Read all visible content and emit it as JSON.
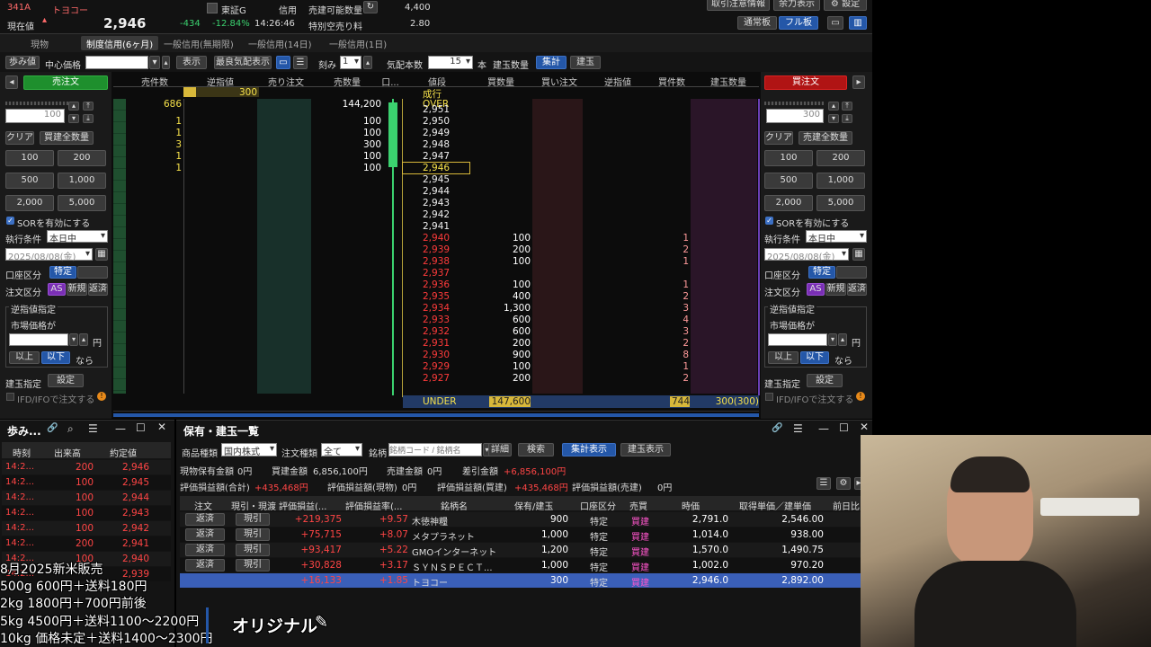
{
  "header": {
    "code": "341A",
    "name": "トヨコー",
    "current_label": "現在値",
    "price": "2,946",
    "change": "-434",
    "change_pct": "-12.84%",
    "time": "14:26:46",
    "market": "東証G",
    "credit_label": "信用",
    "short_avail_label": "売建可能数量",
    "short_avail_value": "4,400",
    "special_fee_label": "特別空売り料",
    "special_fee_value": "2.80",
    "btn_notice": "取引注意情報",
    "btn_display": "余力表示",
    "btn_settings": "設定",
    "btn_normal_board": "通常板",
    "btn_full_board": "フル板"
  },
  "tabs": [
    "現物",
    "制度信用(6ヶ月)",
    "一般信用(無期限)",
    "一般信用(14日)",
    "一般信用(1日)"
  ],
  "toolbar": {
    "tick_btn": "歩み値",
    "center_price": "中心価格",
    "show": "表示",
    "best_show": "最良気配表示",
    "step_label": "刻み",
    "step_value": "1",
    "quote_count_label": "気配本数",
    "quote_count_value": "15",
    "unit": "本",
    "position_qty": "建玉数量",
    "aggregate": "集計",
    "positions": "建玉"
  },
  "order_left": {
    "title": "売注文",
    "qty": "100",
    "clear": "クリア",
    "all_buy_qty": "買建全数量",
    "qty_buttons": [
      "100",
      "200",
      "500",
      "1,000",
      "2,000",
      "5,000"
    ],
    "sor": "SORを有効にする",
    "exec_cond": "執行条件",
    "exec_value": "本日中",
    "date": "2025/08/08(金)",
    "account_type": "口座区分",
    "account_value": "特定",
    "order_type": "注文区分",
    "order_as": "AS",
    "order_new": "新規",
    "order_close": "返済",
    "stop_title": "逆指値指定",
    "market_price": "市場価格が",
    "yen": "円",
    "above": "以上",
    "below": "以下",
    "nara": "なら",
    "pos_spec": "建玉指定",
    "setting": "設定",
    "ifd": "IFD/IFOで注文する"
  },
  "order_right": {
    "title": "買注文",
    "qty": "300",
    "clear": "クリア",
    "all_sell_qty": "売建全数量",
    "qty_buttons": [
      "100",
      "200",
      "500",
      "1,000",
      "2,000",
      "5,000"
    ],
    "sor": "SORを有効にする",
    "exec_cond": "執行条件",
    "exec_value": "本日中",
    "date": "2025/08/08(金)",
    "account_type": "口座区分",
    "account_value": "特定",
    "order_type": "注文区分",
    "order_as": "AS",
    "order_new": "新規",
    "order_close": "返済",
    "stop_title": "逆指値指定",
    "market_price": "市場価格が",
    "yen": "円",
    "above": "以上",
    "below": "以下",
    "nara": "なら",
    "pos_spec": "建玉指定",
    "setting": "設定",
    "ifd": "IFD/IFOで注文する"
  },
  "board": {
    "headers": [
      "売件数",
      "逆指値",
      "売り注文",
      "売数量",
      "口...",
      "値段",
      "買数量",
      "買い注文",
      "逆指値",
      "買件数",
      "建玉数量"
    ],
    "market_row": {
      "label": "成行",
      "rev_val": "300"
    },
    "over_row": {
      "count": "686",
      "qty": "144,200",
      "label": "OVER"
    },
    "ask_rows": [
      {
        "price": "2,951",
        "count": "2",
        "qty": "200"
      },
      {
        "price": "2,950",
        "count": "1",
        "qty": "100"
      },
      {
        "price": "2,949",
        "count": "1",
        "qty": "100"
      },
      {
        "price": "2,948",
        "count": "3",
        "qty": "300"
      },
      {
        "price": "2,947",
        "count": "1",
        "qty": "100"
      },
      {
        "price": "2,946",
        "count": "1",
        "qty": "100"
      }
    ],
    "mid_prices": [
      "2,945",
      "2,944",
      "2,943",
      "2,942",
      "2,941"
    ],
    "bid_rows": [
      {
        "price": "2,940",
        "qty": "100",
        "count": "1"
      },
      {
        "price": "2,939",
        "qty": "200",
        "count": "2"
      },
      {
        "price": "2,938",
        "qty": "100",
        "count": "1"
      },
      {
        "price": "2,937",
        "qty": "",
        "count": ""
      },
      {
        "price": "2,936",
        "qty": "100",
        "count": "1"
      },
      {
        "price": "2,935",
        "qty": "400",
        "count": "2"
      },
      {
        "price": "2,934",
        "qty": "1,300",
        "count": "3"
      },
      {
        "price": "2,933",
        "qty": "600",
        "count": "4"
      },
      {
        "price": "2,932",
        "qty": "600",
        "count": "3"
      },
      {
        "price": "2,931",
        "qty": "200",
        "count": "2"
      },
      {
        "price": "2,930",
        "qty": "900",
        "count": "8"
      },
      {
        "price": "2,929",
        "qty": "100",
        "count": "1"
      },
      {
        "price": "2,927",
        "qty": "200",
        "count": "2"
      }
    ],
    "under_row": {
      "label": "UNDER",
      "qty": "147,600",
      "count": "744",
      "pos": "300(300)"
    }
  },
  "ticks": {
    "title": "歩み...",
    "headers": [
      "時刻",
      "出来高",
      "約定値"
    ],
    "rows": [
      {
        "time": "14:2...",
        "vol": "200",
        "price": "2,946"
      },
      {
        "time": "14:2...",
        "vol": "100",
        "price": "2,945"
      },
      {
        "time": "14:2...",
        "vol": "100",
        "price": "2,944"
      },
      {
        "time": "14:2...",
        "vol": "100",
        "price": "2,943"
      },
      {
        "time": "14:2...",
        "vol": "100",
        "price": "2,942"
      },
      {
        "time": "14:2...",
        "vol": "200",
        "price": "2,941"
      },
      {
        "time": "14:2...",
        "vol": "100",
        "price": "2,940"
      },
      {
        "time": "14:2...",
        "vol": "",
        "price": "2,939"
      }
    ]
  },
  "positions": {
    "title": "保有・建玉一覧",
    "product_label": "商品種類",
    "product_value": "国内株式",
    "order_type_label": "注文種類",
    "order_type_value": "全て",
    "symbol_label": "銘柄",
    "symbol_placeholder": "銘柄コード / 銘柄名",
    "detail": "詳細",
    "search": "検索",
    "agg_view": "集計表示",
    "pos_view": "建玉表示",
    "summary1": [
      {
        "label": "現物保有金額",
        "value": "0円"
      },
      {
        "label": "買建金額",
        "value": "6,856,100円"
      },
      {
        "label": "売建金額",
        "value": "0円"
      },
      {
        "label": "差引金額",
        "value": "+6,856,100円"
      }
    ],
    "summary2": [
      {
        "label": "評価損益額(合計)",
        "value": "+435,468円"
      },
      {
        "label": "評価損益額(現物)",
        "value": "0円"
      },
      {
        "label": "評価損益額(買建)",
        "value": "+435,468円"
      },
      {
        "label": "評価損益額(売建)",
        "value": "0円"
      }
    ],
    "headers": [
      "注文",
      "現引・現渡",
      "評価損益(...",
      "評価損益率(...",
      "銘柄名",
      "保有/建玉",
      "口座区分",
      "売買",
      "時価",
      "取得単価／建単価",
      "前日比"
    ],
    "rows": [
      {
        "btn": "返済",
        "btn2": "現引",
        "pl": "+219,375",
        "pct": "+9.57",
        "name": "木徳神糧",
        "qty": "900",
        "acct": "特定",
        "side": "買建",
        "price": "2,791.0",
        "cost": "2,546.00"
      },
      {
        "btn": "返済",
        "btn2": "現引",
        "pl": "+75,715",
        "pct": "+8.07",
        "name": "メタプラネット",
        "qty": "1,000",
        "acct": "特定",
        "side": "買建",
        "price": "1,014.0",
        "cost": "938.00"
      },
      {
        "btn": "返済",
        "btn2": "現引",
        "pl": "+93,417",
        "pct": "+5.22",
        "name": "GMOインターネット",
        "qty": "1,200",
        "acct": "特定",
        "side": "買建",
        "price": "1,570.0",
        "cost": "1,490.75"
      },
      {
        "btn": "返済",
        "btn2": "現引",
        "pl": "+30,828",
        "pct": "+3.17",
        "name": "ＳＹＮＳＰＥＣＴ...",
        "qty": "1,000",
        "acct": "特定",
        "side": "買建",
        "price": "1,002.0",
        "cost": "970.20"
      },
      {
        "btn": "",
        "btn2": "",
        "pl": "+16,133",
        "pct": "+1.85",
        "name": "トヨコー",
        "qty": "300",
        "acct": "特定",
        "side": "買建",
        "price": "2,946.0",
        "cost": "2,892.00"
      }
    ]
  },
  "overlay": {
    "line1": "8月2025新米販売",
    "line2": "500g  600円＋送料180円",
    "line3": "2kg   1800円＋700円前後",
    "line4": "5kg  4500円＋送料1100～2200円",
    "line5": "10kg  価格未定＋送料1400～2300円",
    "stream_title": "オリジナル"
  },
  "colors": {
    "buy_green": "#1e8f2d",
    "sell_red": "#b01414",
    "accent_blue": "#2457a8",
    "loss_red": "#ff4545",
    "gain_pink": "#ff55cc",
    "highlight_yellow": "#f5e04a"
  }
}
